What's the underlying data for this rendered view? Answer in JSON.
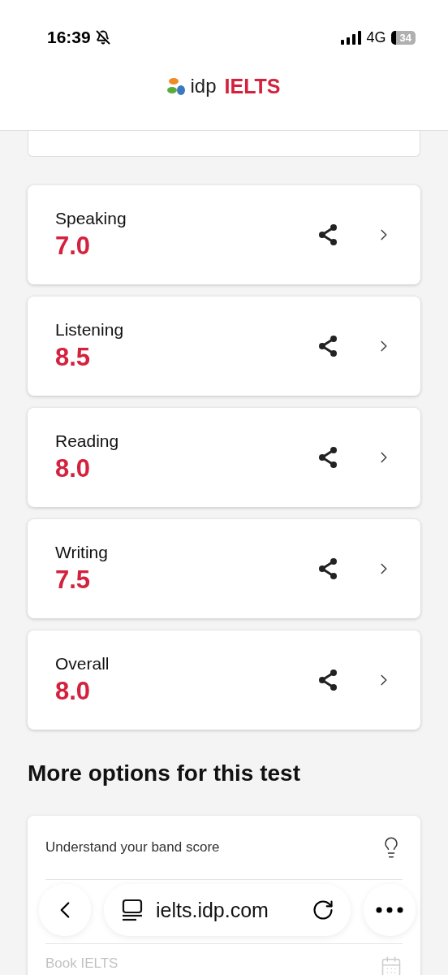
{
  "status_bar": {
    "time": "16:39",
    "network": "4G",
    "battery": "34",
    "silent": true
  },
  "header": {
    "logo_brand": "idp",
    "logo_product": "IELTS"
  },
  "scores": [
    {
      "skill": "Speaking",
      "band": "7.0"
    },
    {
      "skill": "Listening",
      "band": "8.5"
    },
    {
      "skill": "Reading",
      "band": "8.0"
    },
    {
      "skill": "Writing",
      "band": "7.5"
    },
    {
      "skill": "Overall",
      "band": "8.0"
    }
  ],
  "more_options": {
    "title": "More options for this test",
    "items": [
      {
        "label": "Understand your band score",
        "kind": "bulb"
      },
      {
        "label": "Book IELTS",
        "kind": "calendar"
      }
    ]
  },
  "browser_bar": {
    "url": "ielts.idp.com"
  }
}
